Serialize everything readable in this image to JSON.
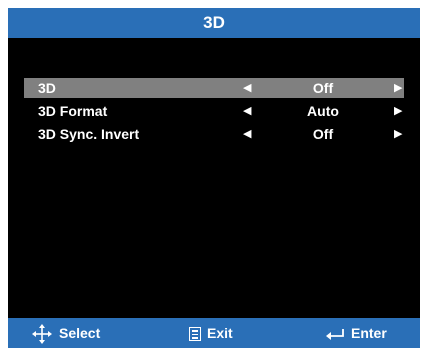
{
  "title": "3D",
  "menu": {
    "items": [
      {
        "label": "3D",
        "value": "Off"
      },
      {
        "label": "3D Format",
        "value": "Auto"
      },
      {
        "label": "3D Sync. Invert",
        "value": "Off"
      }
    ]
  },
  "footer": {
    "select_label": "Select",
    "exit_label": "Exit",
    "enter_label": "Enter"
  },
  "colors": {
    "accent": "#2a6fb7",
    "selected_row": "#808080",
    "background": "#000000"
  },
  "icons": {
    "left_arrow": "triangle-left-icon",
    "right_arrow": "triangle-right-icon",
    "select": "four-way-arrows-icon",
    "exit": "menu-box-icon",
    "enter": "enter-return-icon"
  }
}
